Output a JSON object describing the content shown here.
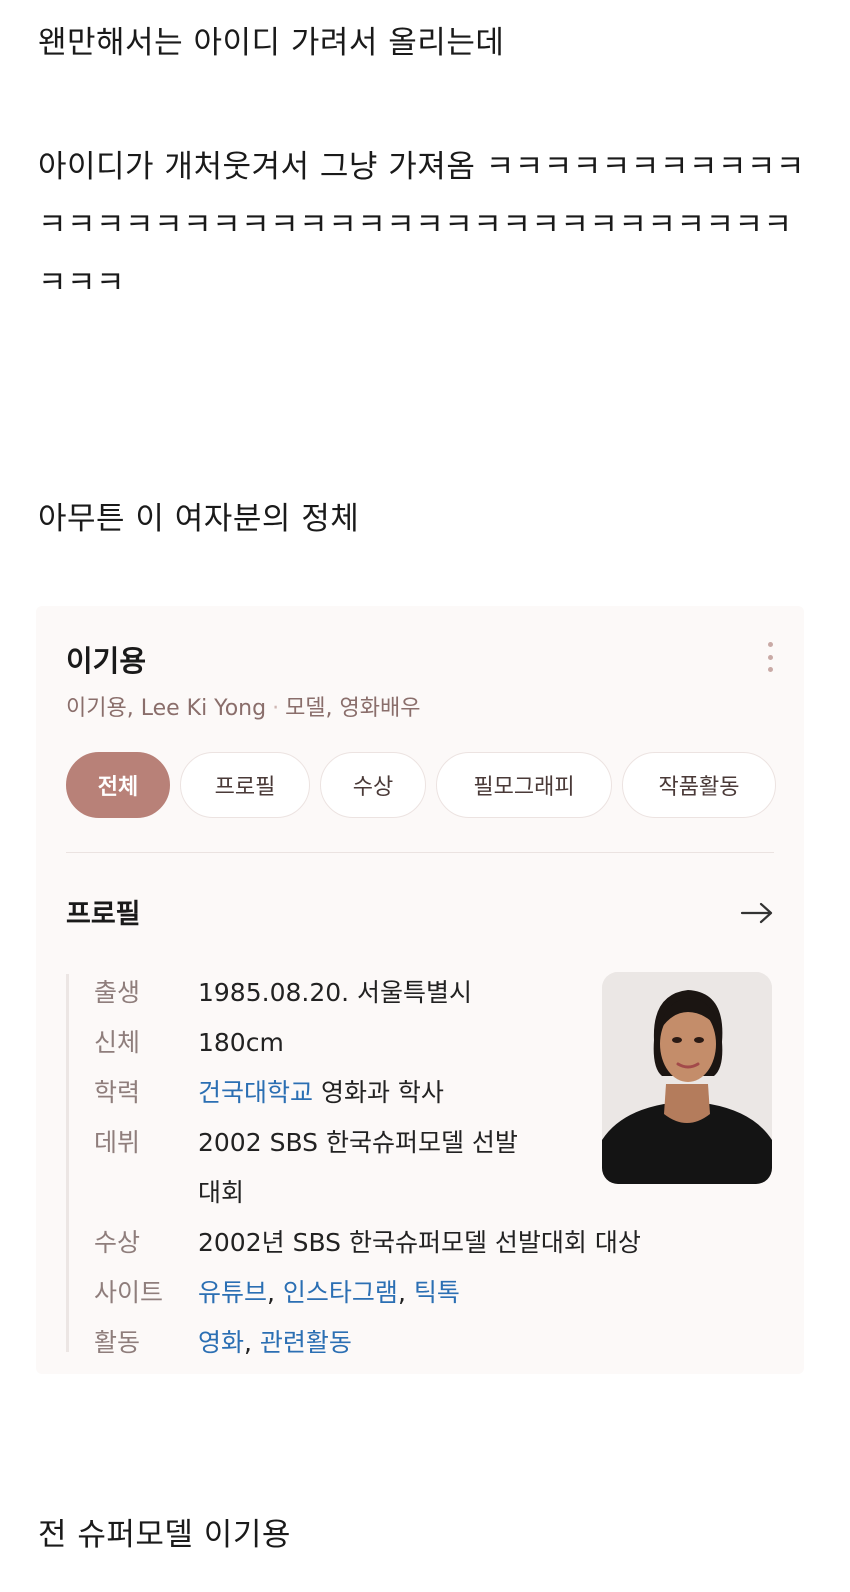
{
  "post": {
    "line1": "왠만해서는 아이디 가려서 올리는데",
    "line2": "아이디가 개처웃겨서 그냥 가져옴 ㅋㅋㅋㅋㅋㅋㅋㅋㅋㅋㅋㅋㅋㅋㅋㅋㅋㅋㅋㅋㅋㅋㅋㅋㅋㅋㅋㅋㅋㅋㅋㅋㅋㅋㅋㅋㅋㅋㅋㅋ",
    "line3": "아무튼 이 여자분의 정체",
    "line4": "전 슈퍼모델 이기용"
  },
  "card": {
    "title": "이기용",
    "subtitle_names": "이기용, Lee Ki Yong",
    "subtitle_jobs": "모델, 영화배우",
    "more_icon": "vertical-ellipsis-icon",
    "tabs": [
      {
        "label": "전체",
        "active": true
      },
      {
        "label": "프로필",
        "active": false
      },
      {
        "label": "수상",
        "active": false
      },
      {
        "label": "필모그래피",
        "active": false
      },
      {
        "label": "작품활동",
        "active": false
      }
    ],
    "section_title": "프로필",
    "arrow_icon": "arrow-right-icon",
    "profile": {
      "birth_key": "출생",
      "birth_value": "1985.08.20. 서울특별시",
      "body_key": "신체",
      "body_value": "180cm",
      "edu_key": "학력",
      "edu_link": "건국대학교",
      "edu_rest": " 영화과 학사",
      "debut_key": "데뷔",
      "debut_value": "2002 SBS 한국슈퍼모델 선발대회",
      "award_key": "수상",
      "award_value": "2002년 SBS 한국슈퍼모델 선발대회 대상",
      "site_key": "사이트",
      "site_links": [
        "유튜브",
        "인스타그램",
        "틱톡"
      ],
      "activity_key": "활동",
      "activity_links": [
        "영화",
        "관련활동"
      ]
    },
    "accent_color": "#b88178",
    "link_color": "#2b6fb3"
  }
}
